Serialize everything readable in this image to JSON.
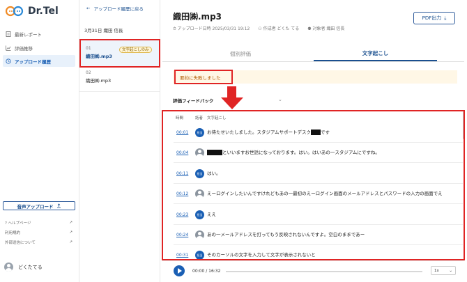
{
  "app": {
    "logo_text": "Dr.Tel"
  },
  "sidebar": {
    "items": [
      {
        "label": "最新レポート",
        "icon": "report-icon"
      },
      {
        "label": "評価推移",
        "icon": "chart-icon"
      },
      {
        "label": "アップロード履歴",
        "icon": "history-icon"
      }
    ],
    "upload_label": "音声アップロード",
    "links": [
      {
        "label": "ヘルプページ"
      },
      {
        "label": "利用規約"
      },
      {
        "label": "外部送信について"
      }
    ],
    "user_name": "どくたてる"
  },
  "list": {
    "back_label": "アップロード履歴に戻る",
    "date_header": "3月31日 織田 信長",
    "files": [
      {
        "num": "01",
        "name": "織田㈱.mp3",
        "tag": "文字起こしのみ"
      },
      {
        "num": "02",
        "name": "織田㈱.mp3"
      }
    ]
  },
  "main": {
    "title": "織田㈱.mp3",
    "upload_meta": "アップロード日時 2025/03/31 19:12",
    "author_meta": "作成者 どくた てる",
    "target_meta": "対象者 織田 信長",
    "pdf_label": "PDF出力",
    "tabs": [
      {
        "label": "個別評価"
      },
      {
        "label": "文字起こし"
      }
    ],
    "alert_text": "要約に失敗しました",
    "feedback_label": "評価フィードバック",
    "table": {
      "headers": [
        "時間",
        "話者",
        "文字起こし"
      ],
      "rows": [
        {
          "time": "00:01",
          "speaker": "staff",
          "pre": "お待たせいたしました。スタジアムサポートデスク",
          "redact": true,
          "post": "です"
        },
        {
          "time": "00:04",
          "speaker": "customer",
          "pre": "",
          "redact": true,
          "post": "といいますお世話になっております。はい。はいあの一スタジアムにですね。"
        },
        {
          "time": "00:11",
          "speaker": "staff",
          "pre": "はい。",
          "redact": false,
          "post": ""
        },
        {
          "time": "00:12",
          "speaker": "customer",
          "pre": "えーログインしたいんですけれどもあの一最初のえーログイン画面のメールアドレスとパスワードの入力の画面でえ",
          "redact": false,
          "post": ""
        },
        {
          "time": "00:23",
          "speaker": "staff",
          "pre": "ええ",
          "redact": false,
          "post": ""
        },
        {
          "time": "00:24",
          "speaker": "customer",
          "pre": "あの一メールアドレスを打ってもう反映されないんですよ。空白のままであー",
          "redact": false,
          "post": ""
        },
        {
          "time": "00:31",
          "speaker": "staff",
          "pre": "そのカーソルの文字を入力して文字が表示されないと",
          "redact": false,
          "post": ""
        }
      ],
      "staff_badge": "担当"
    },
    "player": {
      "time": "00:00 / 16:32",
      "speed": "1x"
    }
  }
}
